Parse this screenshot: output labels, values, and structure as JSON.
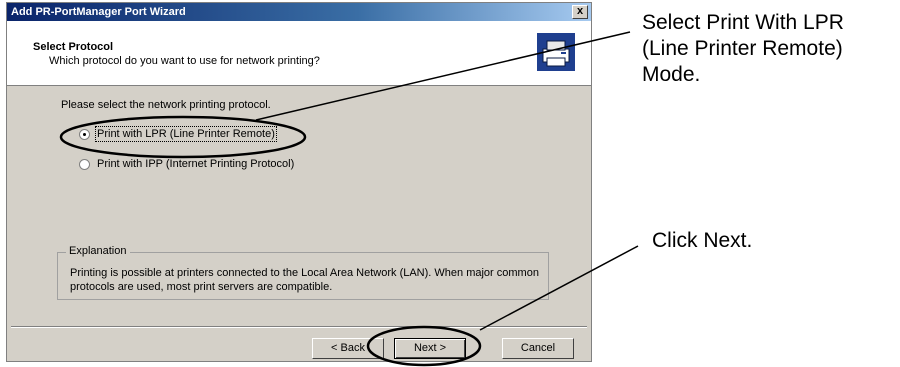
{
  "window": {
    "title": "Add PR-PortManager Port Wizard",
    "close_label": "x"
  },
  "header": {
    "title": "Select Protocol",
    "subtitle": "Which protocol do you want to use for network printing?",
    "icon": "printer-network-icon"
  },
  "body": {
    "prompt": "Please select the network printing protocol.",
    "options": [
      {
        "label": "Print with LPR (Line Printer Remote)",
        "selected": true
      },
      {
        "label": "Print with IPP (Internet Printing Protocol)",
        "selected": false
      }
    ],
    "explanation": {
      "legend": "Explanation",
      "text": "Printing is possible at printers connected to the Local Area Network (LAN). When major common protocols are used, most print servers are compatible."
    }
  },
  "buttons": {
    "back": "< Back",
    "next": "Next >",
    "cancel": "Cancel"
  },
  "callouts": {
    "select_lpr": [
      "Select Print With LPR",
      "(Line Printer Remote)",
      "Mode."
    ],
    "click_next": "Click Next."
  }
}
